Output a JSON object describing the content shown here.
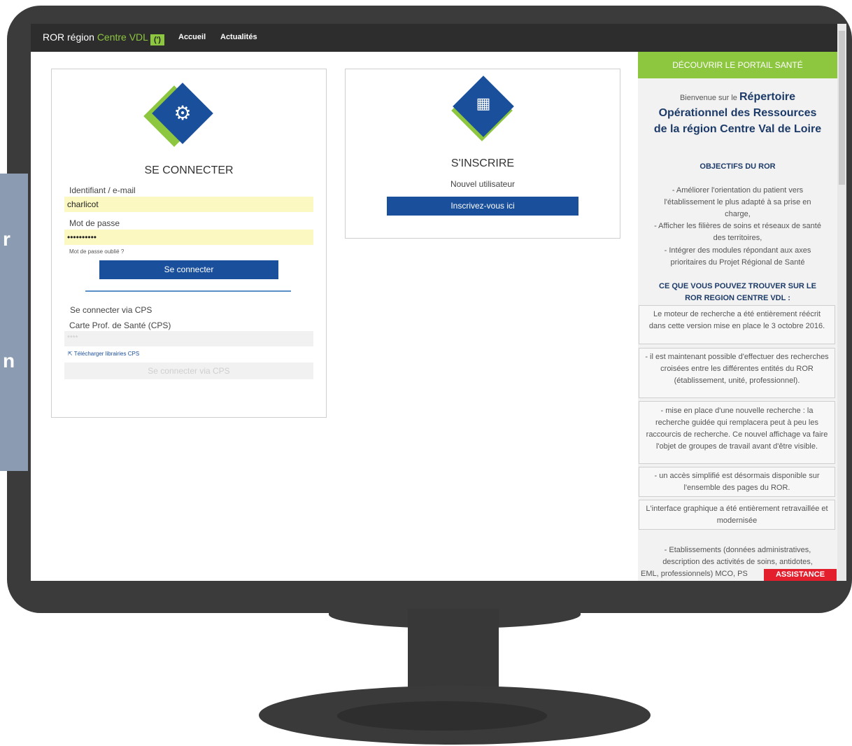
{
  "side": {
    "letters": [
      "r",
      "n"
    ]
  },
  "topbar": {
    "brand_prefix": "ROR région",
    "brand_accent": "Centre VDL",
    "logo_glyph": "(')",
    "nav": [
      "Accueil",
      "Actualités"
    ]
  },
  "login": {
    "title": "SE CONNECTER",
    "identifier_label": "Identifiant / e-mail",
    "identifier_value": "charlicot",
    "password_label": "Mot de passe",
    "password_value": "••••••••••",
    "forgot": "Mot de passe oublié ?",
    "submit": "Se connecter",
    "cps_heading": "Se connecter via CPS",
    "cps_label": "Carte Prof. de Santé (CPS)",
    "cps_placeholder": "****",
    "cps_download": "Télécharger librairies CPS",
    "cps_submit": "Se connecter via CPS"
  },
  "register": {
    "title": "S'INSCRIRE",
    "subtitle": "Nouvel utilisateur",
    "button": "Inscrivez-vous ici"
  },
  "panel": {
    "header": "DÉCOUVRIR LE PORTAIL SANTÉ",
    "welcome_small": "Bienvenue sur le",
    "welcome_big_1": "Répertoire",
    "welcome_big_2": "Opérationnel des Ressources",
    "welcome_big_3": "de la région Centre Val de Loire",
    "objectives_title": "OBJECTIFS DU ROR",
    "objectives": [
      "- Améliorer l'orientation du patient vers",
      "l'établissement le plus adapté à sa prise en",
      "charge,",
      "- Afficher les filières de soins et réseaux de santé",
      "des territoires,",
      "- Intégrer des modules répondant aux axes",
      "prioritaires du Projet Régional de Santé"
    ],
    "find_title_1": "CE QUE VOUS POUVEZ TROUVER SUR LE",
    "find_title_2": "ROR REGION CENTRE VDL :",
    "boxes": [
      "Le moteur de recherche a été entièrement réécrit dans cette version mise en place le 3 octobre 2016.",
      "- il est maintenant possible d'effectuer des recherches croisées entre les différentes entités du ROR (établissement, unité, professionnel).",
      "- mise en place d'une nouvelle recherche : la recherche guidée qui remplacera peut à peu les raccourcis de recherche. Ce nouvel affichage va faire l'objet de groupes de travail avant d'être visible.",
      "- un accès simplifié est désormais disponible sur l'ensemble des pages du ROR.",
      "L'interface graphique a été entièrement retravaillée et modernisée"
    ],
    "bottom_lines": [
      "- Etablissements (données administratives,",
      "description des activités de soins, antidotes,",
      "EML, professionnels) MCO, PS"
    ],
    "assistance": "ASSISTANCE"
  }
}
